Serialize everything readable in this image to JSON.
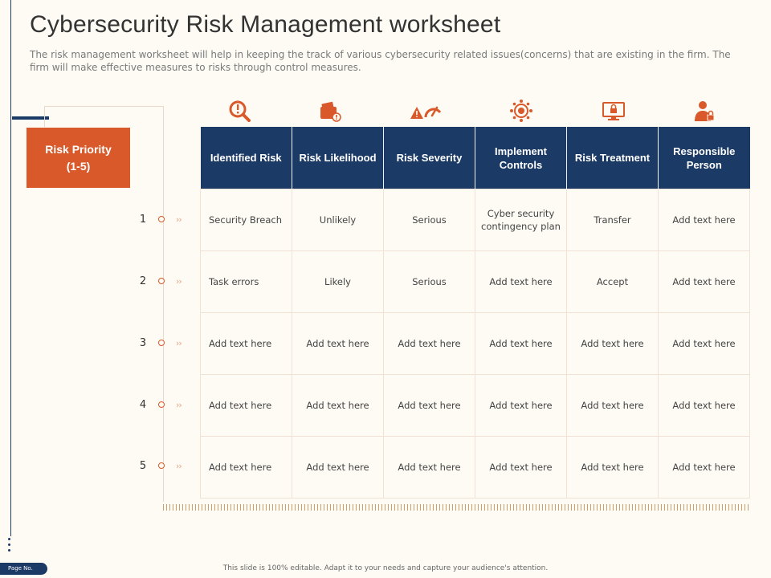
{
  "header": {
    "title": "Cybersecurity Risk Management worksheet",
    "subtitle": "The risk management worksheet will help in keeping the track of various cybersecurity related issues(concerns)  that are existing in the firm. The firm will make effective measures to risks through control measures."
  },
  "priority": {
    "label_line1": "Risk Priority",
    "label_line2": "(1-5)"
  },
  "colors": {
    "navy": "#1b3a66",
    "orange": "#d9592a",
    "background": "#fdfbf3"
  },
  "icons": [
    "risk-search-icon",
    "wallet-alert-icon",
    "warning-gauge-icon",
    "gear-network-icon",
    "monitor-lock-icon",
    "person-lock-icon"
  ],
  "table": {
    "headers": [
      "Identified Risk",
      "Risk Likelihood",
      "Risk Severity",
      "Implement Controls",
      "Risk Treatment",
      "Responsible Person"
    ],
    "rows": [
      {
        "num": "1",
        "cells": [
          "Security Breach",
          "Unlikely",
          "Serious",
          "Cyber security contingency plan",
          "Transfer",
          "Add text here"
        ]
      },
      {
        "num": "2",
        "cells": [
          "Task errors",
          "Likely",
          "Serious",
          "Add text here",
          "Accept",
          "Add text here"
        ]
      },
      {
        "num": "3",
        "cells": [
          "Add text here",
          "Add text here",
          "Add text here",
          "Add text here",
          "Add text here",
          "Add text here"
        ]
      },
      {
        "num": "4",
        "cells": [
          "Add text here",
          "Add text here",
          "Add text here",
          "Add text here",
          "Add text here",
          "Add text here"
        ]
      },
      {
        "num": "5",
        "cells": [
          "Add text here",
          "Add text here",
          "Add text here",
          "Add text here",
          "Add text here",
          "Add text here"
        ]
      }
    ]
  },
  "footer": {
    "page_label": "Page No.",
    "note": "This slide is 100% editable. Adapt it to your needs and capture your audience's attention."
  }
}
